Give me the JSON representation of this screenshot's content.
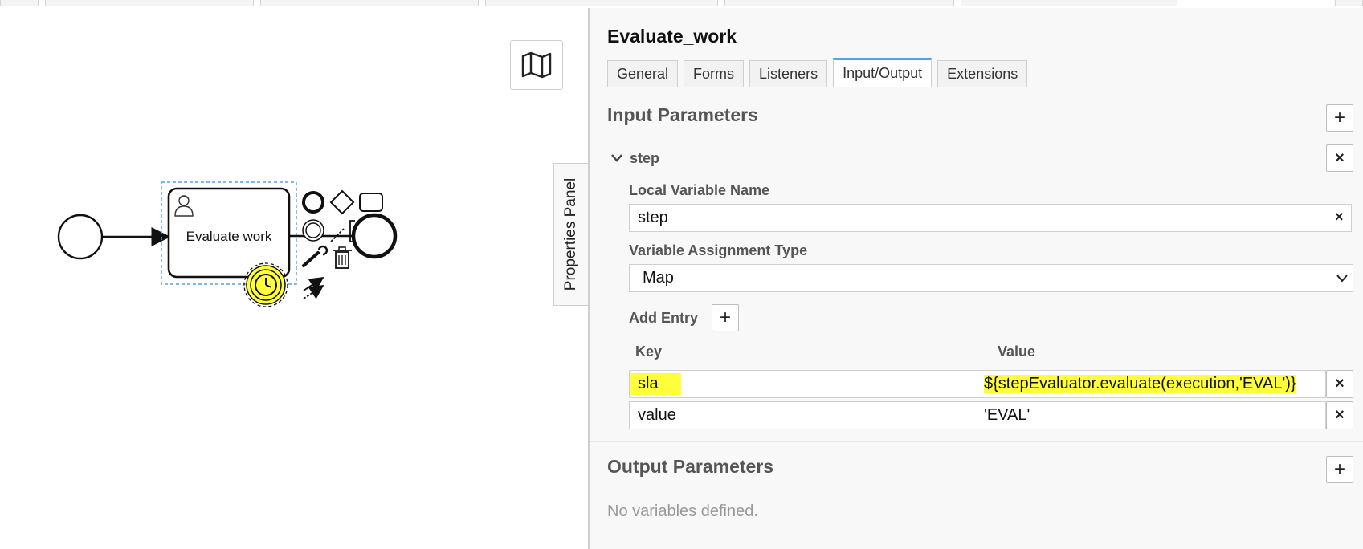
{
  "panel": {
    "element_title": "Evaluate_work",
    "toggle_label": "Properties Panel",
    "tabs": [
      {
        "label": "General"
      },
      {
        "label": "Forms"
      },
      {
        "label": "Listeners"
      },
      {
        "label": "Input/Output"
      },
      {
        "label": "Extensions"
      }
    ],
    "active_tab": "Input/Output",
    "input_parameters": {
      "title": "Input Parameters",
      "add_symbol": "+",
      "parameter": {
        "name": "step",
        "remove_symbol": "×",
        "local_variable_name_label": "Local Variable Name",
        "local_variable_name_value": "step",
        "variable_assignment_type_label": "Variable Assignment Type",
        "variable_assignment_type_value": "Map",
        "add_entry_label": "Add Entry",
        "add_entry_symbol": "+",
        "columns": {
          "key": "Key",
          "value": "Value"
        },
        "entries": [
          {
            "key": "sla",
            "value": "${stepEvaluator.evaluate(execution,'EVAL')}",
            "remove_symbol": "×"
          },
          {
            "key": "value",
            "value": "'EVAL'",
            "remove_symbol": "×"
          }
        ]
      }
    },
    "output_parameters": {
      "title": "Output Parameters",
      "add_symbol": "+",
      "empty_text": "No variables defined."
    }
  },
  "diagram": {
    "task_label": "Evaluate work",
    "highlight_color": "#ffff3b",
    "accent_color": "#52a2e5"
  }
}
